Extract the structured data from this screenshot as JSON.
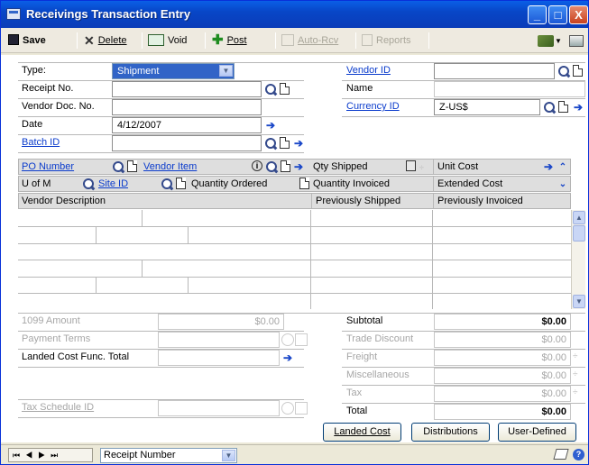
{
  "window": {
    "title": "Receivings Transaction Entry",
    "min_glyph": "_",
    "max_glyph": "□",
    "close_glyph": "X"
  },
  "toolbar": {
    "save": "Save",
    "delete": "Delete",
    "void": "Void",
    "post": "Post",
    "auto_rcv": "Auto-Rcv",
    "reports": "Reports"
  },
  "header": {
    "type_label": "Type:",
    "type_value": "Shipment",
    "receipt_label": "Receipt No.",
    "receipt_value": "",
    "vendor_doc_label": "Vendor Doc. No.",
    "vendor_doc_value": "",
    "date_label": "Date",
    "date_value": "4/12/2007",
    "batch_label": "Batch ID",
    "batch_value": "",
    "vendor_id_label": "Vendor ID",
    "vendor_id_value": "",
    "name_label": "Name",
    "name_value": "",
    "currency_label": "Currency ID",
    "currency_value": "Z-US$"
  },
  "grid": {
    "row1": {
      "po_number": "PO Number",
      "vendor_item": "Vendor Item",
      "qty_shipped": "Qty Shipped",
      "unit_cost": "Unit Cost"
    },
    "row2": {
      "u_of_m": "U of M",
      "site_id": "Site ID",
      "qty_ordered": "Quantity Ordered",
      "qty_invoiced": "Quantity Invoiced",
      "extended_cost": "Extended Cost"
    },
    "row3": {
      "vendor_desc": "Vendor Description",
      "prev_shipped": "Previously Shipped",
      "prev_invoiced": "Previously Invoiced"
    }
  },
  "totals": {
    "amt1099_label": "1099 Amount",
    "amt1099_value": "$0.00",
    "payment_terms_label": "Payment Terms",
    "landed_cost_label": "Landed Cost Func. Total",
    "tax_schedule_label": "Tax Schedule ID",
    "subtotal_label": "Subtotal",
    "subtotal_value": "$0.00",
    "trade_discount_label": "Trade Discount",
    "trade_discount_value": "$0.00",
    "freight_label": "Freight",
    "freight_value": "$0.00",
    "misc_label": "Miscellaneous",
    "misc_value": "$0.00",
    "tax_label": "Tax",
    "tax_value": "$0.00",
    "total_label": "Total",
    "total_value": "$0.00"
  },
  "buttons": {
    "landed_cost": "Landed Cost",
    "distributions": "Distributions",
    "user_defined": "User-Defined"
  },
  "status": {
    "sort_value": "Receipt Number"
  }
}
